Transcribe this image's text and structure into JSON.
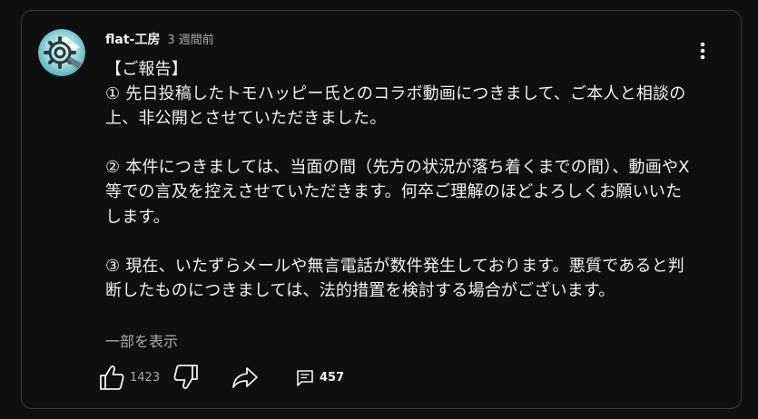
{
  "comment": {
    "author": "flat-工房",
    "time": "3 週間前",
    "text": "【ご報告】\n① 先日投稿したトモハッピー氏とのコラボ動画につきまして、ご本人と相談の上、非公開とさせていただきました。\n\n② 本件につきましては、当面の間（先方の状況が落ち着くまでの間）、動画やX等での言及を控えさせていただきます。何卒ご理解のほどよろしくお願いいたします。\n\n③ 現在、いたずらメールや無言電話が数件発生しております。悪質であると判断したものにつきましては、法的措置を検討する場合がございます。",
    "show_more_label": "一部を表示",
    "like_count": "1423",
    "reply_count": "457"
  },
  "colors": {
    "background": "#0f0f0f",
    "border": "#3a3a3a",
    "text_primary": "#f1f1f1",
    "text_secondary": "#aaaaaa"
  },
  "icons": {
    "avatar": "gear-logo-avatar",
    "menu": "more-vertical-icon",
    "like": "thumb-up-icon",
    "dislike": "thumb-down-icon",
    "share": "share-arrow-icon",
    "reply": "comment-bubble-icon"
  }
}
